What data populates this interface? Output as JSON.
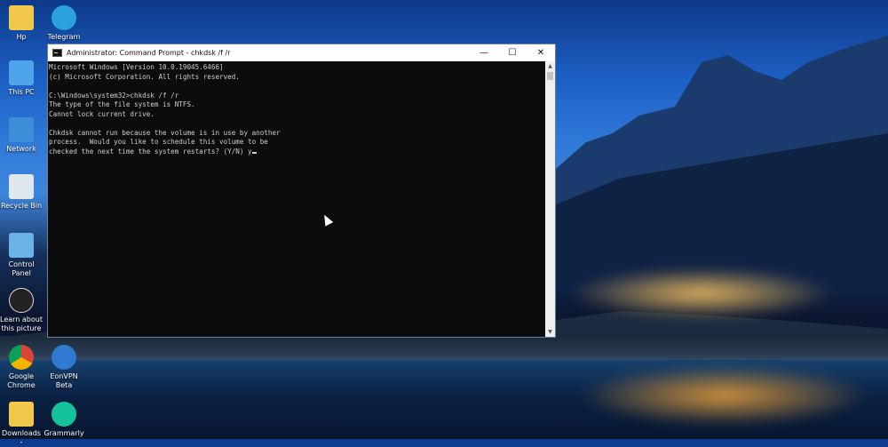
{
  "desktop": {
    "icons": [
      {
        "label": "Hp"
      },
      {
        "label": "Telegram"
      },
      {
        "label": "This PC"
      },
      {
        "label": "Network"
      },
      {
        "label": "Recycle Bin"
      },
      {
        "label": "Control Panel"
      },
      {
        "label": "Learn about this picture"
      },
      {
        "label": "Google Chrome"
      },
      {
        "label": "EonVPN Beta"
      },
      {
        "label": "Downloads -"
      },
      {
        "label": "Grammarly"
      }
    ]
  },
  "window": {
    "title": "Administrator: Command Prompt - chkdsk  /f /r",
    "minimize": "—",
    "maximize": "☐",
    "close": "✕",
    "console_lines": [
      "Microsoft Windows [Version 10.0.19045.6466]",
      "(c) Microsoft Corporation. All rights reserved.",
      "",
      "C:\\Windows\\system32>chkdsk /f /r",
      "The type of the file system is NTFS.",
      "Cannot lock current drive.",
      "",
      "Chkdsk cannot run because the volume is in use by another",
      "process.  Would you like to schedule this volume to be",
      "checked the next time the system restarts? (Y/N) y"
    ]
  },
  "colors": {
    "console_bg": "#0c0c0c",
    "console_text": "#cfcfcf"
  }
}
